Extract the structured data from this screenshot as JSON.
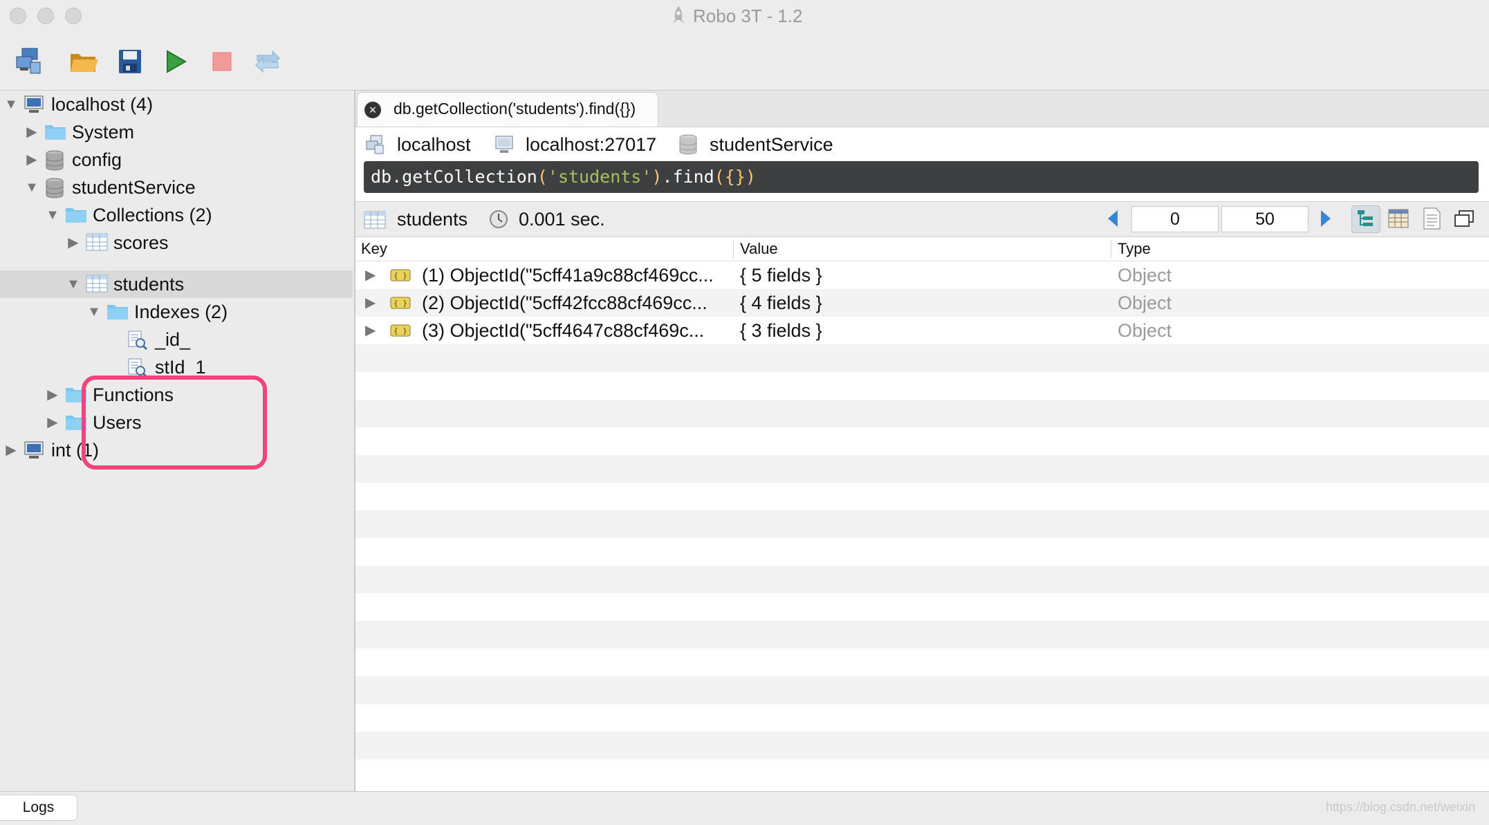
{
  "window": {
    "title": "Robo 3T - 1.2"
  },
  "toolbar": {
    "buttons": [
      "connect-icon",
      "open-icon",
      "save-icon",
      "execute-icon",
      "stop-icon",
      "refresh-icon"
    ]
  },
  "sidebar": {
    "nodes": {
      "localhost": "localhost (4)",
      "system": "System",
      "config": "config",
      "studentService": "studentService",
      "collections": "Collections (2)",
      "scores": "scores",
      "students": "students",
      "indexes": "Indexes (2)",
      "index_id": "_id_",
      "index_stId": "stId_1",
      "functions": "Functions",
      "users": "Users",
      "int": "int (1)"
    },
    "selected": "students",
    "highlight_color": "#f0457a"
  },
  "query_tab": {
    "label": "db.getCollection('students').find({})"
  },
  "connection": {
    "server": "localhost",
    "address": "localhost:27017",
    "database": "studentService"
  },
  "editor": {
    "tokens": {
      "t1": "db.getCollection",
      "t2": "(",
      "t3": "'students'",
      "t4": ")",
      "t5": ".find",
      "t6": "({})"
    }
  },
  "results": {
    "collection": "students",
    "time": "0.001 sec.",
    "skip": "0",
    "limit": "50",
    "columns": {
      "key": "Key",
      "value": "Value",
      "type": "Type"
    },
    "rows": [
      {
        "key": "(1) ObjectId(\"5cff41a9c88cf469cc...",
        "value": "{ 5 fields }",
        "type": "Object"
      },
      {
        "key": "(2) ObjectId(\"5cff42fcc88cf469cc...",
        "value": "{ 4 fields }",
        "type": "Object"
      },
      {
        "key": "(3) ObjectId(\"5cff4647c88cf469c...",
        "value": "{ 3 fields }",
        "type": "Object"
      }
    ]
  },
  "bottom": {
    "logs_label": "Logs",
    "watermark": "https://blog.csdn.net/weixin"
  }
}
